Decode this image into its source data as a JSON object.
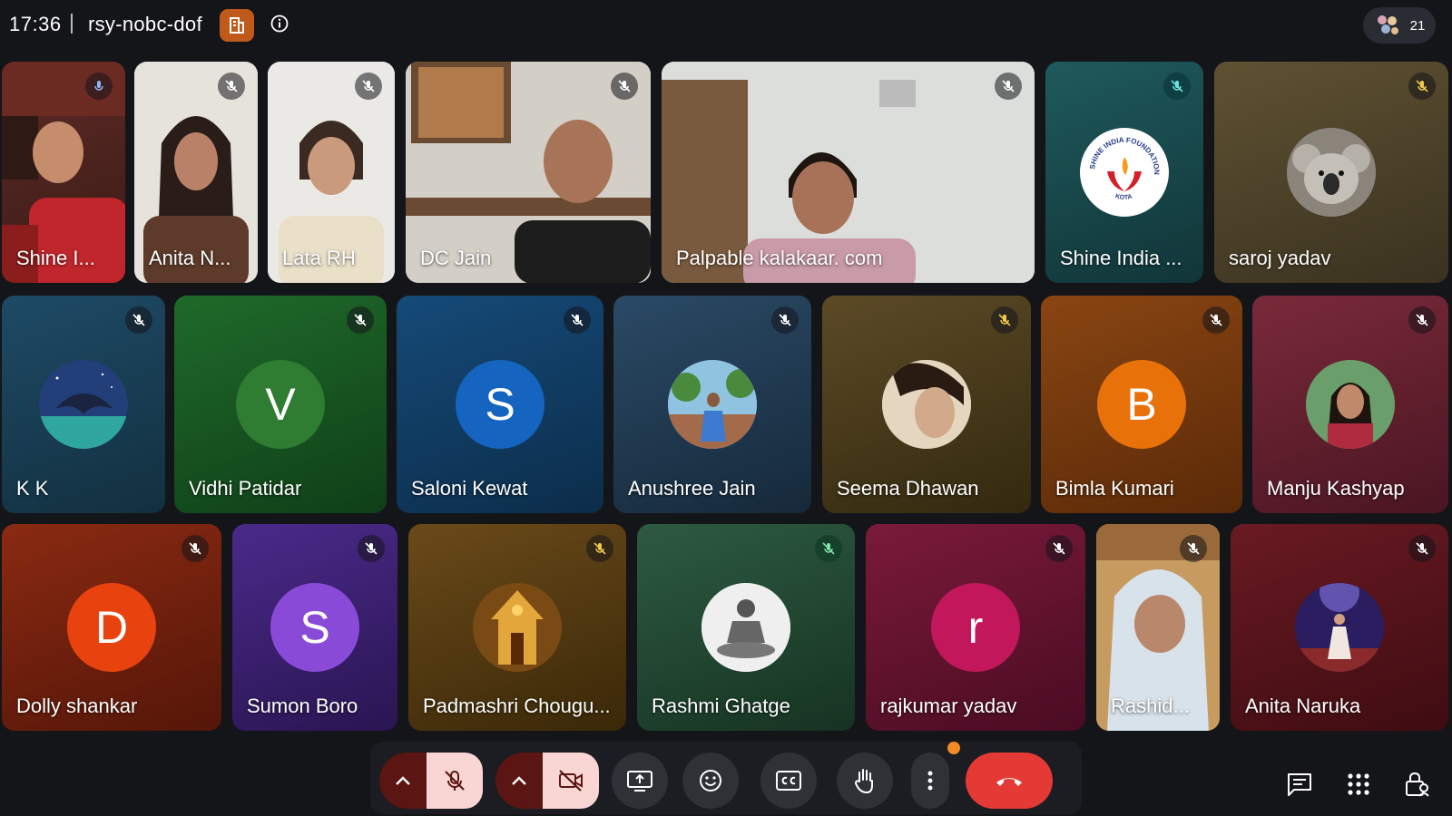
{
  "meeting": {
    "time": "17:36",
    "code": "rsy-nobc-dof",
    "participant_count": "21"
  },
  "tiles": [
    {
      "name": "Shine I..."
    },
    {
      "name": "Anita N..."
    },
    {
      "name": "Lata RH"
    },
    {
      "name": "DC Jain"
    },
    {
      "name": "Palpable kalakaar. com"
    },
    {
      "name": "Shine India ..."
    },
    {
      "name": "saroj yadav"
    },
    {
      "name": "K K"
    },
    {
      "name": "Vidhi Patidar",
      "initial": "V"
    },
    {
      "name": "Saloni Kewat",
      "initial": "S"
    },
    {
      "name": "Anushree Jain"
    },
    {
      "name": "Seema Dhawan"
    },
    {
      "name": "Bimla Kumari",
      "initial": "B"
    },
    {
      "name": "Manju Kashyap"
    },
    {
      "name": "Dolly shankar",
      "initial": "D"
    },
    {
      "name": "Sumon Boro",
      "initial": "S"
    },
    {
      "name": "Padmashri Chougu..."
    },
    {
      "name": "Rashmi Ghatge"
    },
    {
      "name": "rajkumar yadav",
      "initial": "r"
    },
    {
      "name": "Rashid..."
    },
    {
      "name": "Anita Naruka"
    }
  ],
  "logo_text": {
    "shine_india": "SHINE INDIA FOUNDATION",
    "kota": "KOTA"
  },
  "colors": {
    "end_call": "#e53935",
    "muted_bg": "#f9d6d3",
    "muted_dark": "#5b1512",
    "accent_orange": "#f28b25"
  }
}
